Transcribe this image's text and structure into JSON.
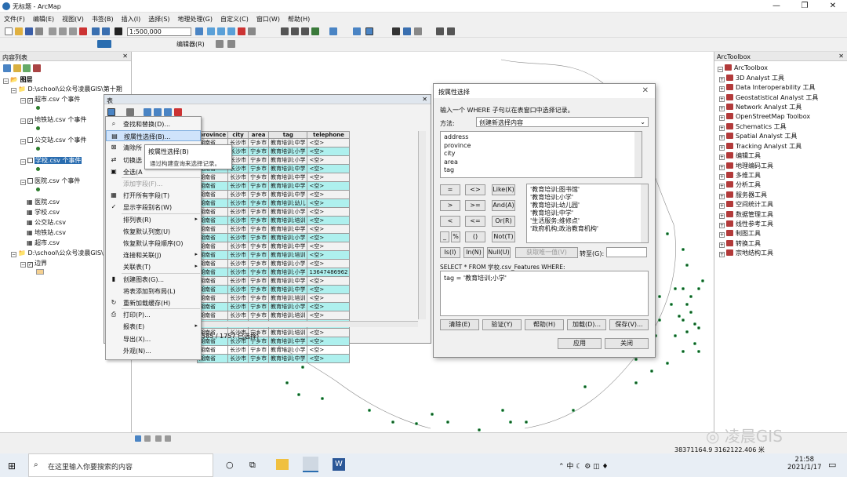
{
  "window": {
    "title": "无标题 - ArcMap"
  },
  "menu": [
    "文件(F)",
    "编辑(E)",
    "视图(V)",
    "书签(B)",
    "插入(I)",
    "选择(S)",
    "地理处理(G)",
    "自定义(C)",
    "窗口(W)",
    "帮助(H)"
  ],
  "toolbar": {
    "scale": "1:500,000",
    "editor_label": "编辑器(R)"
  },
  "toc": {
    "title": "内容列表",
    "layers_root": "图层",
    "folder1": "D:\\school\\公众号凌晨GIS\\第十期",
    "layers": [
      {
        "label": "超市.csv 个事件",
        "checked": true
      },
      {
        "label": "地铁站.csv 个事件",
        "checked": true
      },
      {
        "label": "公交站.csv 个事件",
        "checked": false
      },
      {
        "label": "学校.csv 个事件",
        "checked": false,
        "selected": true
      },
      {
        "label": "医院.csv 个事件",
        "checked": false
      }
    ],
    "tables": [
      "医院.csv",
      "学校.csv",
      "公交站.csv",
      "地铁站.csv",
      "超市.csv"
    ],
    "folder2": "D:\\school\\公众号凌晨GIS\\",
    "boundary": "边界"
  },
  "table_window": {
    "title": "表",
    "headers": [
      "province",
      "city",
      "area",
      "tag",
      "telephone"
    ],
    "left_fragments": {
      "r7": "幼儿园",
      "r13": "例约100米）"
    },
    "rows": [
      [
        "湖南省",
        "长沙市",
        "宁乡市",
        "教育培训;中学",
        "<空>"
      ],
      [
        "湖南省",
        "长沙市",
        "宁乡市",
        "教育培训;小学",
        "<空>"
      ],
      [
        "湖南省",
        "长沙市",
        "宁乡市",
        "教育培训;小学",
        "<空>"
      ],
      [
        "湖南省",
        "长沙市",
        "宁乡市",
        "教育培训;中学",
        "<空>"
      ],
      [
        "湖南省",
        "长沙市",
        "宁乡市",
        "教育培训;中学",
        "<空>"
      ],
      [
        "湖南省",
        "长沙市",
        "宁乡市",
        "教育培训;中学",
        "<空>"
      ],
      [
        "湖南省",
        "长沙市",
        "宁乡市",
        "教育培训;中学",
        "<空>"
      ],
      [
        "湖南省",
        "长沙市",
        "宁乡市",
        "教育培训;幼儿",
        "<空>"
      ],
      [
        "湖南省",
        "长沙市",
        "宁乡市",
        "教育培训;小学",
        "<空>"
      ],
      [
        "湖南省",
        "长沙市",
        "宁乡市",
        "教育培训;培训",
        "<空>"
      ],
      [
        "湖南省",
        "长沙市",
        "宁乡市",
        "教育培训;中学",
        "<空>"
      ],
      [
        "湖南省",
        "长沙市",
        "宁乡市",
        "教育培训;小学",
        "<空>"
      ],
      [
        "湖南省",
        "长沙市",
        "宁乡市",
        "教育培训;中学",
        "<空>"
      ],
      [
        "湖南省",
        "长沙市",
        "宁乡市",
        "教育培训;培训",
        "<空>"
      ],
      [
        "湖南省",
        "长沙市",
        "宁乡市",
        "教育培训;小学",
        "<空>"
      ],
      [
        "湖南省",
        "长沙市",
        "宁乡市",
        "教育培训;小学",
        "13647486962"
      ],
      [
        "湖南省",
        "长沙市",
        "宁乡市",
        "教育培训;中学",
        "<空>"
      ],
      [
        "湖南省",
        "长沙市",
        "宁乡市",
        "教育培训;中学",
        "<空>"
      ],
      [
        "湖南省",
        "长沙市",
        "宁乡市",
        "教育培训;培训",
        "<空>"
      ],
      [
        "湖南省",
        "长沙市",
        "宁乡市",
        "教育培训;小学",
        "<空>"
      ],
      [
        "湖南省",
        "长沙市",
        "宁乡市",
        "教育培训;培训",
        "<空>"
      ],
      [
        "湖南省",
        "长沙市",
        "宁乡市",
        "教育培训;小学",
        "<空>"
      ],
      [
        "湖南省",
        "长沙市",
        "宁乡市",
        "教育培训;培训",
        "<空>"
      ],
      [
        "湖南省",
        "长沙市",
        "宁乡市",
        "教育培训;中学",
        "<空>"
      ],
      [
        "湖南省",
        "长沙市",
        "宁乡市",
        "教育培训;小学",
        "<空>"
      ],
      [
        "湖南省",
        "长沙市",
        "宁乡市",
        "教育培训;中学",
        "<空>"
      ]
    ],
    "status": "585 / 1757 已选择)"
  },
  "context_menu": {
    "items": [
      {
        "label": "查找和替换(D)...",
        "icon": "binoculars-icon"
      },
      {
        "label": "按属性选择(B)...",
        "icon": "select-by-attributes-icon",
        "highlight": true
      },
      {
        "label": "清除所",
        "icon": "clear-selection-icon"
      },
      {
        "label": "切换选",
        "icon": "switch-selection-icon"
      },
      {
        "label": "全选(A",
        "icon": "select-all-icon"
      },
      {
        "label": "添加字段(F)...",
        "disabled": true
      },
      {
        "label": "打开所有字段(T)",
        "icon": "fields-icon"
      },
      {
        "label": "显示字段别名(W)",
        "icon": "checkmark-icon"
      },
      {
        "label": "排列表(R)",
        "sub": true
      },
      {
        "label": "恢复默认列宽(U)"
      },
      {
        "label": "恢复默认字段顺序(O)"
      },
      {
        "label": "连接和关联(J)",
        "sub": true
      },
      {
        "label": "关联表(T)",
        "sub": true
      },
      {
        "label": "创建图表(G)...",
        "icon": "chart-icon"
      },
      {
        "label": "将表添加到布局(L)"
      },
      {
        "label": "重新加载缓存(H)",
        "icon": "reload-icon"
      },
      {
        "label": "打印(P)...",
        "icon": "print-icon"
      },
      {
        "label": "报表(E)",
        "sub": true
      },
      {
        "label": "导出(X)..."
      },
      {
        "label": "外观(N)..."
      }
    ]
  },
  "tooltip": {
    "title": "按属性选择(B)",
    "body": "通过构建查询来选择记录。"
  },
  "dialog": {
    "title": "按属性选择",
    "prompt": "输入一个 WHERE 子句以在表窗口中选择记录。",
    "method_label": "方法:",
    "method_value": "创建新选择内容",
    "fields": [
      "address",
      "province",
      "city",
      "area",
      "tag"
    ],
    "ops": [
      "=",
      "<>",
      "Like(K)",
      ">",
      ">=",
      "And(A)",
      "<",
      "<=",
      "Or(R)",
      "_",
      "%",
      "()",
      "Not(T)"
    ],
    "ops2": [
      "Is(I)",
      "In(N)",
      "Null(U)"
    ],
    "unique_btn": "获取唯一值(V)",
    "goto_label": "转至(G):",
    "values": [
      "'教育培训;图书馆'",
      "'教育培训;小学'",
      "'教育培训;幼儿园'",
      "'教育培训;中学'",
      "'生活服务;维修点'",
      "'政府机构;政治教育机构'"
    ],
    "sql_label": "SELECT * FROM 学校.csv_Features WHERE:",
    "sql": "tag = '教育培训;小学'",
    "buttons": [
      "清除(E)",
      "验证(Y)",
      "帮助(H)",
      "加载(D)...",
      "保存(V)..."
    ],
    "apply": "应用",
    "close": "关闭"
  },
  "arctoolbox": {
    "title": "ArcToolbox",
    "root": "ArcToolbox",
    "items": [
      "3D Analyst 工具",
      "Data Interoperability 工具",
      "Geostatistical Analyst 工具",
      "Network Analyst 工具",
      "OpenStreetMap Toolbox",
      "Schematics 工具",
      "Spatial Analyst 工具",
      "Tracking Analyst 工具",
      "编辑工具",
      "地理编码工具",
      "多维工具",
      "分析工具",
      "服务器工具",
      "空间统计工具",
      "数据管理工具",
      "线性参考工具",
      "制图工具",
      "转换工具",
      "宗地结构工具"
    ]
  },
  "status": {
    "coords": "38371164.9 3162122.406 米",
    "watermark": "凌晨GIS"
  },
  "taskbar": {
    "search": "在这里输入你要搜索的内容",
    "time": "21:58",
    "date": "2021/1/17",
    "tray_lang": "中"
  }
}
